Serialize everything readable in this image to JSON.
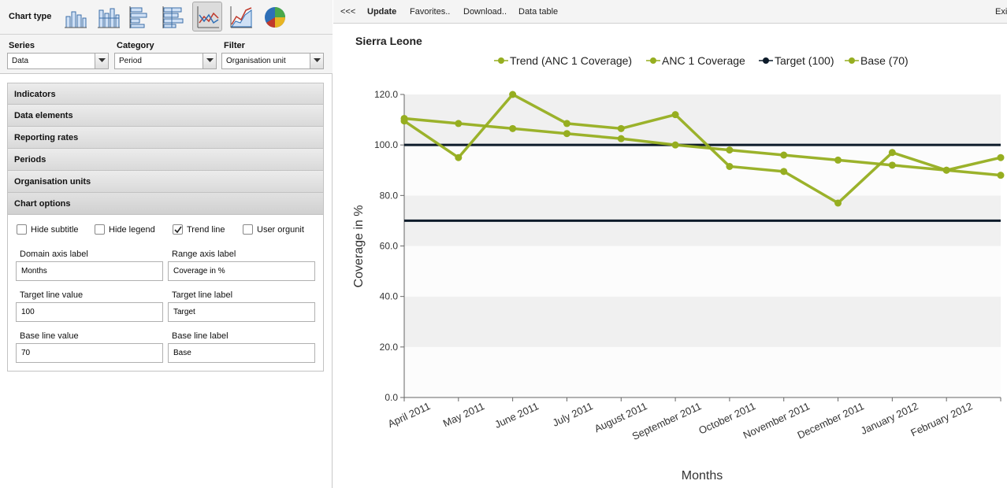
{
  "left_panel": {
    "chart_type_label": "Chart type",
    "chart_types": [
      {
        "icon": "column-chart-icon"
      },
      {
        "icon": "stacked-column-chart-icon"
      },
      {
        "icon": "bar-chart-icon"
      },
      {
        "icon": "stacked-bar-chart-icon"
      },
      {
        "icon": "line-chart-icon",
        "active": true
      },
      {
        "icon": "area-chart-icon"
      },
      {
        "icon": "pie-chart-icon"
      }
    ],
    "series": {
      "label": "Series",
      "value": "Data"
    },
    "category": {
      "label": "Category",
      "value": "Period"
    },
    "filter": {
      "label": "Filter",
      "value": "Organisation unit"
    },
    "sections": [
      "Indicators",
      "Data elements",
      "Reporting rates",
      "Periods",
      "Organisation units",
      "Chart options"
    ],
    "chart_options": {
      "checkboxes": [
        {
          "label": "Hide subtitle",
          "checked": false
        },
        {
          "label": "Hide legend",
          "checked": false
        },
        {
          "label": "Trend line",
          "checked": true
        },
        {
          "label": "User orgunit",
          "checked": false
        }
      ],
      "domain_axis_label": {
        "label": "Domain axis label",
        "value": "Months"
      },
      "range_axis_label": {
        "label": "Range axis label",
        "value": "Coverage in %"
      },
      "target_line_value": {
        "label": "Target line value",
        "value": "100"
      },
      "target_line_label": {
        "label": "Target line label",
        "value": "Target"
      },
      "base_line_value": {
        "label": "Base line value",
        "value": "70"
      },
      "base_line_label": {
        "label": "Base line label",
        "value": "Base"
      }
    }
  },
  "toolbar": {
    "collapse": "<<<",
    "update": "Update",
    "favorites": "Favorites..",
    "download": "Download..",
    "data_table": "Data table",
    "exit": "Exi"
  },
  "colors": {
    "accent": "#96ae20",
    "target": "#0d1b2a",
    "band": "#f0f0f0"
  },
  "chart_data": {
    "type": "line",
    "title": "Sierra Leone",
    "xlabel": "Months",
    "ylabel": "Coverage in %",
    "ylim": [
      0,
      120
    ],
    "yticks": [
      "0.0",
      "20.0",
      "40.0",
      "60.0",
      "80.0",
      "100.0",
      "120.0"
    ],
    "grid": "horizontal bands",
    "legend": "top-center",
    "categories": [
      "April 2011",
      "May 2011",
      "June 2011",
      "July 2011",
      "August 2011",
      "September 2011",
      "October 2011",
      "November 2011",
      "December 2011",
      "January 2012",
      "February 2012"
    ],
    "series": [
      {
        "name": "Trend (ANC 1 Coverage)",
        "values": [
          110.5,
          108.5,
          106.5,
          104.5,
          102.5,
          100.0,
          98.0,
          96.0,
          94.0,
          92.0,
          90.0,
          88.0
        ]
      },
      {
        "name": "ANC 1 Coverage",
        "values": [
          109.5,
          95.0,
          120.0,
          108.5,
          106.5,
          112.0,
          91.5,
          89.5,
          77.0,
          97.0,
          90.0,
          95.0
        ]
      },
      {
        "name": "Target (100)",
        "values": [
          100,
          100,
          100,
          100,
          100,
          100,
          100,
          100,
          100,
          100,
          100,
          100
        ]
      },
      {
        "name": "Base (70)",
        "values": [
          70,
          70,
          70,
          70,
          70,
          70,
          70,
          70,
          70,
          70,
          70,
          70
        ]
      }
    ]
  }
}
